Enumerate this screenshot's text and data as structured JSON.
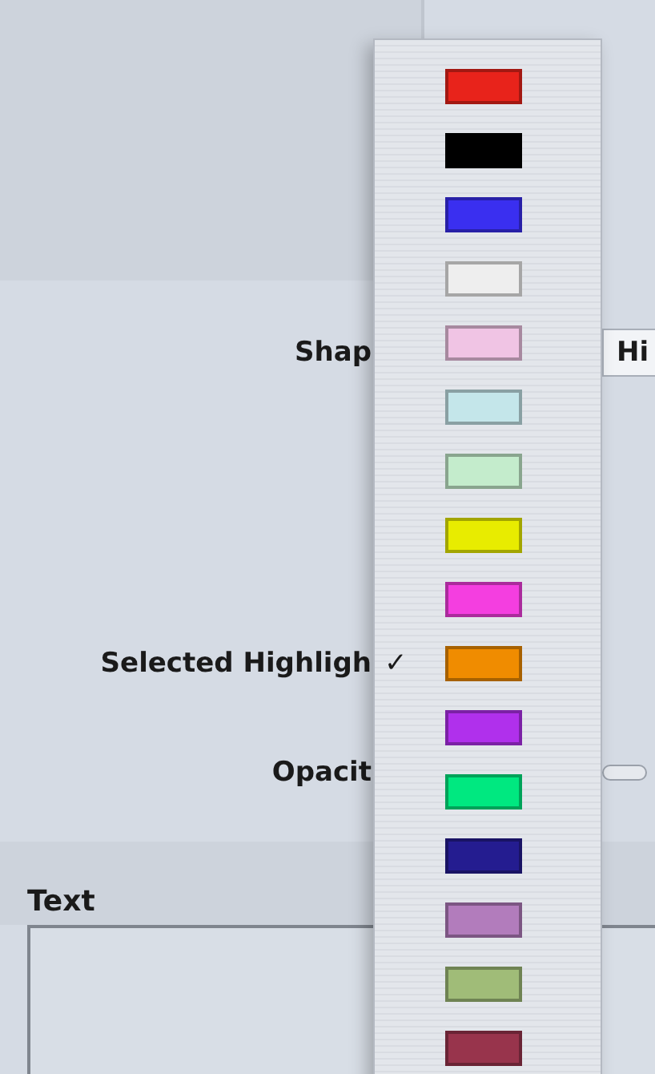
{
  "inspector": {
    "shape_label": "Shap",
    "shape_field_value": "Hi",
    "highlight_label": "Selected Highligh",
    "opacity_label": "Opacit"
  },
  "text_section": {
    "title": "Text"
  },
  "color_menu": {
    "check_mark": "✓",
    "items": [
      {
        "color": "#e8231b",
        "selected": false
      },
      {
        "color": "#000000",
        "selected": false
      },
      {
        "color": "#3a2ff0",
        "selected": false
      },
      {
        "color": "#eeeeee",
        "selected": false
      },
      {
        "color": "#f0c4e4",
        "selected": false
      },
      {
        "color": "#c4e6ea",
        "selected": false
      },
      {
        "color": "#c4eccc",
        "selected": false
      },
      {
        "color": "#e8ec00",
        "selected": false
      },
      {
        "color": "#f43ee0",
        "selected": false
      },
      {
        "color": "#f08c00",
        "selected": true
      },
      {
        "color": "#b030ec",
        "selected": false
      },
      {
        "color": "#00e880",
        "selected": false
      },
      {
        "color": "#241c90",
        "selected": false
      },
      {
        "color": "#b27cbc",
        "selected": false
      },
      {
        "color": "#a0bc78",
        "selected": false
      },
      {
        "color": "#98344c",
        "selected": false
      }
    ]
  }
}
